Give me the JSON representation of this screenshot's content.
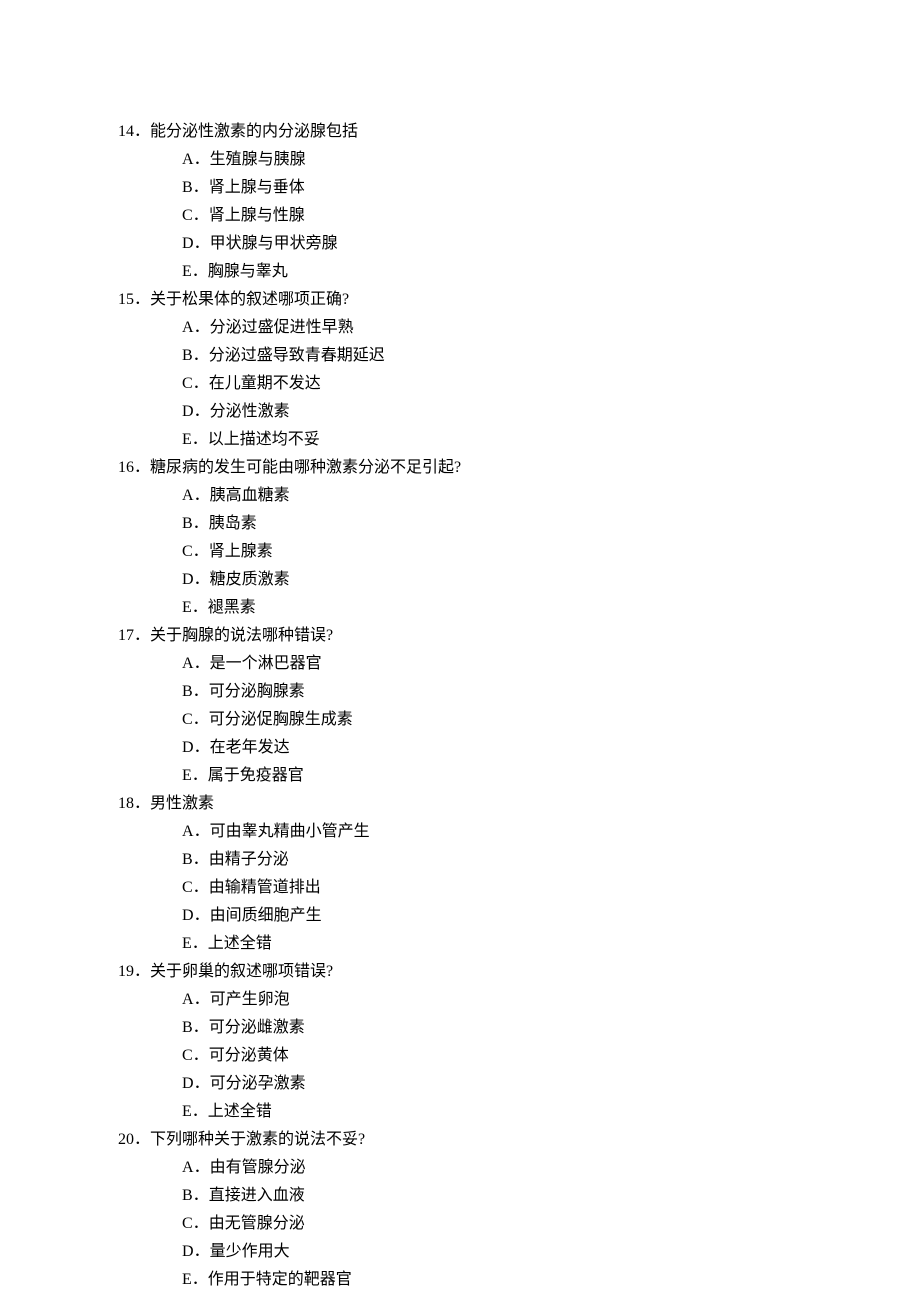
{
  "questions": [
    {
      "number": "14",
      "text": "能分泌性激素的内分泌腺包括",
      "options": [
        {
          "letter": "A",
          "text": "生殖腺与胰腺"
        },
        {
          "letter": "B",
          "text": "肾上腺与垂体"
        },
        {
          "letter": "C",
          "text": "肾上腺与性腺"
        },
        {
          "letter": "D",
          "text": "甲状腺与甲状旁腺"
        },
        {
          "letter": "E",
          "text": "胸腺与睾丸"
        }
      ]
    },
    {
      "number": "15",
      "text": "关于松果体的叙述哪项正确?",
      "options": [
        {
          "letter": "A",
          "text": "分泌过盛促进性早熟"
        },
        {
          "letter": "B",
          "text": "分泌过盛导致青春期延迟"
        },
        {
          "letter": "C",
          "text": "在儿童期不发达"
        },
        {
          "letter": "D",
          "text": "分泌性激素"
        },
        {
          "letter": "E",
          "text": "以上描述均不妥"
        }
      ]
    },
    {
      "number": "16",
      "text": "糖尿病的发生可能由哪种激素分泌不足引起?",
      "options": [
        {
          "letter": "A",
          "text": "胰高血糖素"
        },
        {
          "letter": "B",
          "text": "胰岛素"
        },
        {
          "letter": "C",
          "text": "肾上腺素"
        },
        {
          "letter": "D",
          "text": "糖皮质激素"
        },
        {
          "letter": "E",
          "text": "褪黑素"
        }
      ]
    },
    {
      "number": "17",
      "text": "关于胸腺的说法哪种错误?",
      "options": [
        {
          "letter": "A",
          "text": "是一个淋巴器官"
        },
        {
          "letter": "B",
          "text": "可分泌胸腺素"
        },
        {
          "letter": "C",
          "text": "可分泌促胸腺生成素"
        },
        {
          "letter": "D",
          "text": "在老年发达"
        },
        {
          "letter": "E",
          "text": "属于免疫器官"
        }
      ]
    },
    {
      "number": "18",
      "text": "男性激素",
      "options": [
        {
          "letter": "A",
          "text": "可由睾丸精曲小管产生"
        },
        {
          "letter": "B",
          "text": "由精子分泌"
        },
        {
          "letter": "C",
          "text": "由输精管道排出"
        },
        {
          "letter": "D",
          "text": "由间质细胞产生"
        },
        {
          "letter": "E",
          "text": "上述全错"
        }
      ]
    },
    {
      "number": "19",
      "text": "关于卵巢的叙述哪项错误?",
      "options": [
        {
          "letter": "A",
          "text": "可产生卵泡"
        },
        {
          "letter": "B",
          "text": "可分泌雌激素"
        },
        {
          "letter": "C",
          "text": "可分泌黄体"
        },
        {
          "letter": "D",
          "text": "可分泌孕激素"
        },
        {
          "letter": "E",
          "text": "上述全错"
        }
      ]
    },
    {
      "number": "20",
      "text": "下列哪种关于激素的说法不妥?",
      "options": [
        {
          "letter": "A",
          "text": "由有管腺分泌"
        },
        {
          "letter": "B",
          "text": "直接进入血液"
        },
        {
          "letter": "C",
          "text": "由无管腺分泌"
        },
        {
          "letter": "D",
          "text": "量少作用大"
        },
        {
          "letter": "E",
          "text": "作用于特定的靶器官"
        }
      ]
    }
  ]
}
